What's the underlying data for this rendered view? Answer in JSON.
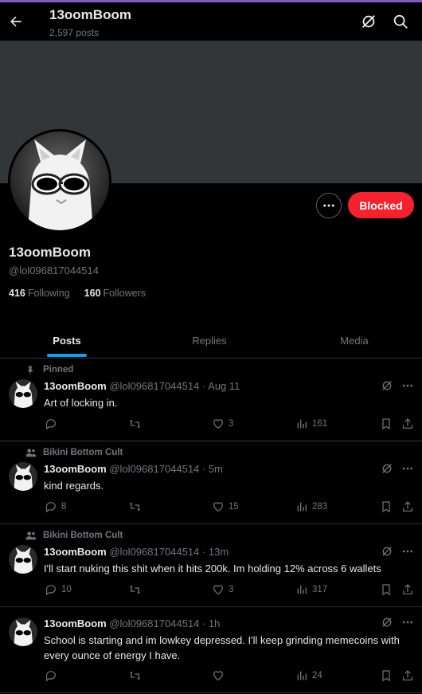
{
  "header": {
    "name": "13oomBoom",
    "post_count": "2,597 posts"
  },
  "profile": {
    "name": "13oomBoom",
    "handle": "@lol096817044514",
    "following_count": "416",
    "following_label": "Following",
    "followers_count": "160",
    "followers_label": "Followers",
    "blocked_label": "Blocked"
  },
  "tabs": [
    {
      "label": "Posts",
      "active": true
    },
    {
      "label": "Replies",
      "active": false
    },
    {
      "label": "Media",
      "active": false
    }
  ],
  "posts": [
    {
      "context": "Pinned",
      "context_icon": "pin-icon",
      "name": "13oomBoom",
      "handle_time": "@lol096817044514 · Aug 11",
      "text": "Art of locking in.",
      "replies": "",
      "reposts": "",
      "likes": "3",
      "views": "161"
    },
    {
      "context": "Bikini Bottom Cult",
      "context_icon": "community-icon",
      "name": "13oomBoom",
      "handle_time": "@lol096817044514 · 5m",
      "text": "kind regards.",
      "replies": "8",
      "reposts": "",
      "likes": "15",
      "views": "283"
    },
    {
      "context": "Bikini Bottom Cult",
      "context_icon": "community-icon",
      "name": "13oomBoom",
      "handle_time": "@lol096817044514 · 13m",
      "text": "I'll start nuking this shit when it hits 200k. Im holding 12% across 6 wallets",
      "replies": "10",
      "reposts": "",
      "likes": "3",
      "views": "317"
    },
    {
      "context": "",
      "name": "13oomBoom",
      "handle_time": "@lol096817044514 · 1h",
      "text": "School is starting and im lowkey depressed. I'll keep grinding memecoins with every ounce of energy I have.",
      "replies": "",
      "reposts": "",
      "likes": "",
      "views": "24"
    }
  ],
  "colors": {
    "accent": "#1d9bf0",
    "blocked": "#f4212e",
    "banner": "#333639"
  }
}
